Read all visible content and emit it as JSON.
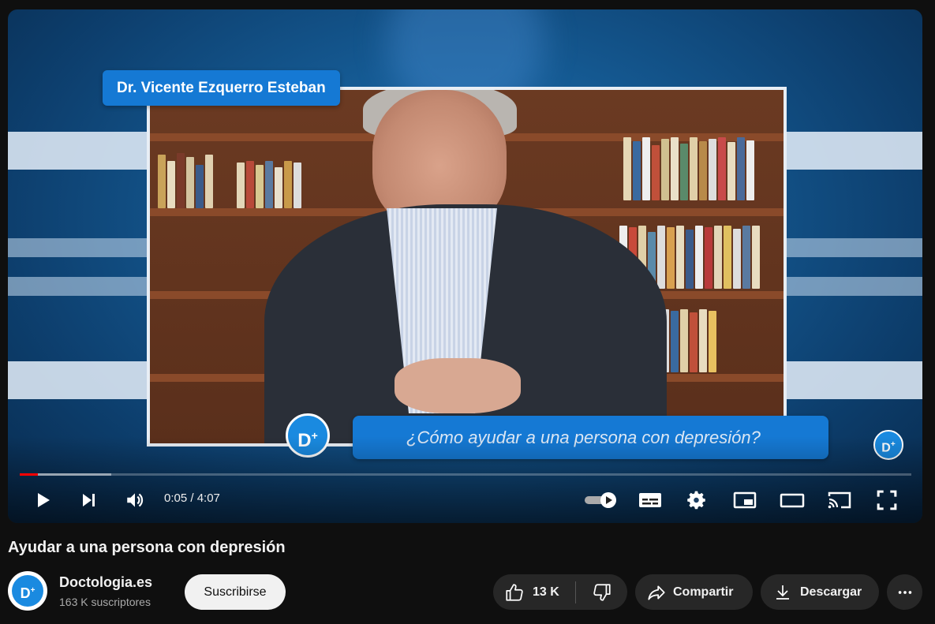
{
  "video": {
    "name_tag": "Dr. Vicente Ezquerro Esteban",
    "question_banner": "¿Cómo ayudar a una persona con depresión?",
    "logo_text": "D",
    "logo_plus": "+",
    "progress_fraction": 0.02,
    "buffer_fraction": 0.103
  },
  "controls": {
    "time": "0:05 / 4:07",
    "icons": [
      "play-icon",
      "next-icon",
      "volume-icon",
      "autoplay-toggle-icon",
      "subtitles-icon",
      "settings-gear-icon",
      "miniplayer-icon",
      "theater-mode-icon",
      "cast-icon",
      "fullscreen-icon"
    ]
  },
  "meta": {
    "title": "Ayudar a una persona con depresión",
    "channel_name": "Doctologia.es",
    "subscribers": "163 K suscriptores",
    "subscribe_label": "Suscribirse",
    "likes": "13 K",
    "share_label": "Compartir",
    "download_label": "Descargar"
  },
  "colors": {
    "brand_blue": "#1579d4",
    "progress_red": "#ff0000",
    "background": "#0f0f0f"
  }
}
